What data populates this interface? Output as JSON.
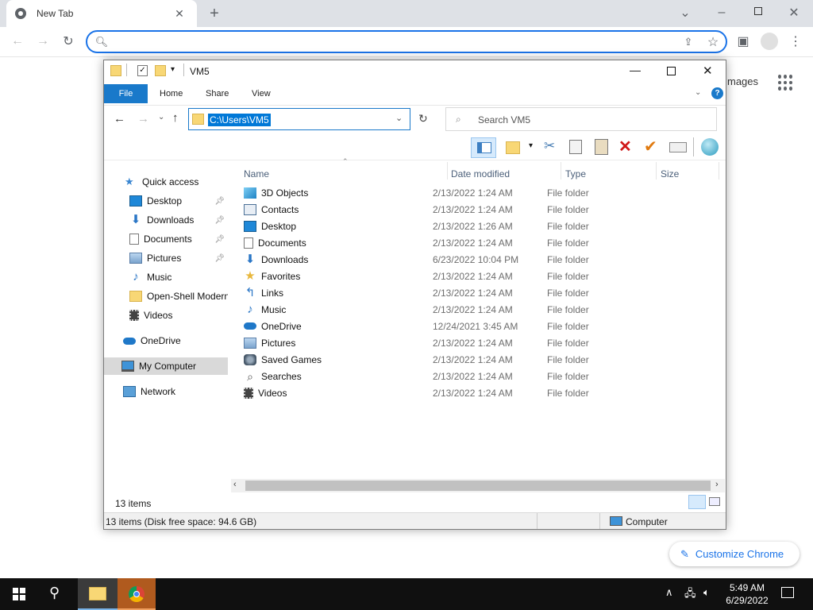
{
  "chrome": {
    "tab_title": "New Tab",
    "new_tab_symbol": "+",
    "omnibox_value": "",
    "images_link": "mages",
    "customize_label": "Customize Chrome"
  },
  "explorer": {
    "title": "VM5",
    "ribbon_tabs": [
      "File",
      "Home",
      "Share",
      "View"
    ],
    "address": "C:\\Users\\VM5",
    "search_placeholder": "Search VM5",
    "columns": {
      "name": "Name",
      "date": "Date modified",
      "type": "Type",
      "size": "Size"
    },
    "nav": {
      "quick_access": "Quick access",
      "quick_items": [
        {
          "label": "Desktop",
          "pinned": true
        },
        {
          "label": "Downloads",
          "pinned": true
        },
        {
          "label": "Documents",
          "pinned": true
        },
        {
          "label": "Pictures",
          "pinned": true
        },
        {
          "label": "Music",
          "pinned": false
        },
        {
          "label": "Open-Shell Modern",
          "pinned": false
        },
        {
          "label": "Videos",
          "pinned": false
        }
      ],
      "onedrive": "OneDrive",
      "my_computer": "My Computer",
      "network": "Network"
    },
    "files": [
      {
        "name": "3D Objects",
        "date": "2/13/2022 1:24 AM",
        "type": "File folder",
        "icon": "3d-objects-icon"
      },
      {
        "name": "Contacts",
        "date": "2/13/2022 1:24 AM",
        "type": "File folder",
        "icon": "contacts-icon"
      },
      {
        "name": "Desktop",
        "date": "2/13/2022 1:26 AM",
        "type": "File folder",
        "icon": "desktop-icon"
      },
      {
        "name": "Documents",
        "date": "2/13/2022 1:24 AM",
        "type": "File folder",
        "icon": "documents-icon"
      },
      {
        "name": "Downloads",
        "date": "6/23/2022 10:04 PM",
        "type": "File folder",
        "icon": "downloads-icon"
      },
      {
        "name": "Favorites",
        "date": "2/13/2022 1:24 AM",
        "type": "File folder",
        "icon": "star-icon"
      },
      {
        "name": "Links",
        "date": "2/13/2022 1:24 AM",
        "type": "File folder",
        "icon": "links-icon"
      },
      {
        "name": "Music",
        "date": "2/13/2022 1:24 AM",
        "type": "File folder",
        "icon": "music-icon"
      },
      {
        "name": "OneDrive",
        "date": "12/24/2021 3:45 AM",
        "type": "File folder",
        "icon": "cloud-icon"
      },
      {
        "name": "Pictures",
        "date": "2/13/2022 1:24 AM",
        "type": "File folder",
        "icon": "pictures-icon"
      },
      {
        "name": "Saved Games",
        "date": "2/13/2022 1:24 AM",
        "type": "File folder",
        "icon": "saved-games-icon"
      },
      {
        "name": "Searches",
        "date": "2/13/2022 1:24 AM",
        "type": "File folder",
        "icon": "search-icon"
      },
      {
        "name": "Videos",
        "date": "2/13/2022 1:24 AM",
        "type": "File folder",
        "icon": "videos-icon"
      }
    ],
    "item_count": "13 items",
    "status_text": "13 items (Disk free space: 94.6 GB)",
    "status_location": "Computer"
  },
  "taskbar": {
    "time": "5:49 AM",
    "date": "6/29/2022"
  },
  "colors": {
    "accent": "#1979ca",
    "selection": "#0078d7",
    "chrome_blue": "#1a73e8"
  }
}
